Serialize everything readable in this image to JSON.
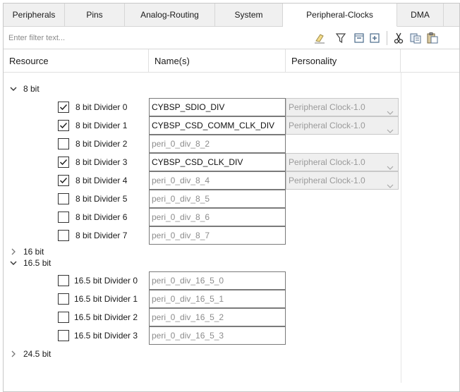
{
  "tabs": [
    {
      "label": "Peripherals",
      "active": false
    },
    {
      "label": "Pins",
      "active": false
    },
    {
      "label": "Analog-Routing",
      "active": false
    },
    {
      "label": "System",
      "active": false
    },
    {
      "label": "Peripheral-Clocks",
      "active": true
    },
    {
      "label": "DMA",
      "active": false
    }
  ],
  "filter": {
    "placeholder": "Enter filter text..."
  },
  "toolbar_icons": [
    "eraser-icon",
    "filter-icon",
    "collapse-all-icon",
    "expand-all-icon",
    "cut-icon",
    "copy-icon",
    "paste-icon"
  ],
  "columns": {
    "resource": "Resource",
    "names": "Name(s)",
    "personality": "Personality"
  },
  "groups": {
    "g8": {
      "label": "8 bit",
      "expanded": true
    },
    "g16": {
      "label": "16 bit",
      "expanded": false
    },
    "g165": {
      "label": "16.5 bit",
      "expanded": true
    },
    "g245": {
      "label": "24.5 bit",
      "expanded": false
    }
  },
  "dividers8": [
    {
      "label": "8 bit Divider 0",
      "checked": true,
      "name": "CYBSP_SDIO_DIV",
      "personality": "Peripheral Clock-1.0"
    },
    {
      "label": "8 bit Divider 1",
      "checked": true,
      "name": "CYBSP_CSD_COMM_CLK_DIV",
      "personality": "Peripheral Clock-1.0"
    },
    {
      "label": "8 bit Divider 2",
      "checked": false,
      "name": "peri_0_div_8_2",
      "personality": ""
    },
    {
      "label": "8 bit Divider 3",
      "checked": true,
      "name": "CYBSP_CSD_CLK_DIV",
      "personality": "Peripheral Clock-1.0"
    },
    {
      "label": "8 bit Divider 4",
      "checked": true,
      "name": "peri_0_div_8_4",
      "personality": "Peripheral Clock-1.0"
    },
    {
      "label": "8 bit Divider 5",
      "checked": false,
      "name": "peri_0_div_8_5",
      "personality": ""
    },
    {
      "label": "8 bit Divider 6",
      "checked": false,
      "name": "peri_0_div_8_6",
      "personality": ""
    },
    {
      "label": "8 bit Divider 7",
      "checked": false,
      "name": "peri_0_div_8_7",
      "personality": ""
    }
  ],
  "dividers165": [
    {
      "label": "16.5 bit Divider 0",
      "checked": false,
      "name": "peri_0_div_16_5_0",
      "personality": ""
    },
    {
      "label": "16.5 bit Divider 1",
      "checked": false,
      "name": "peri_0_div_16_5_1",
      "personality": ""
    },
    {
      "label": "16.5 bit Divider 2",
      "checked": false,
      "name": "peri_0_div_16_5_2",
      "personality": ""
    },
    {
      "label": "16.5 bit Divider 3",
      "checked": false,
      "name": "peri_0_div_16_5_3",
      "personality": ""
    }
  ]
}
